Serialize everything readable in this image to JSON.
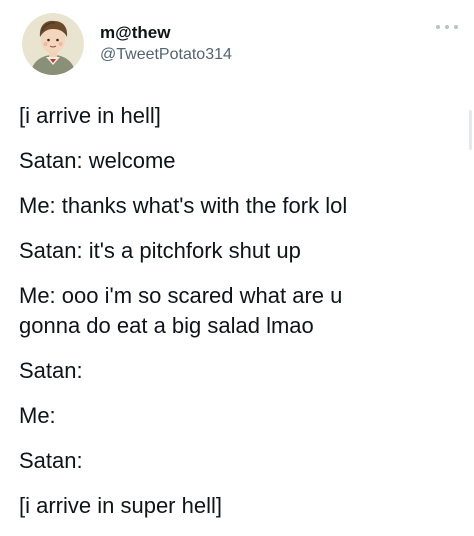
{
  "author": {
    "display_name": "m@thew",
    "handle": "@TweetPotato314",
    "avatar_icon": "cartoon-avatar"
  },
  "menu_icon": "more-dots-icon",
  "lines": [
    "[i arrive in hell]",
    "Satan: welcome",
    "Me: thanks what's with the fork lol",
    "Satan: it's a pitchfork shut up",
    "Me: ooo i'm so scared what are u",
    "gonna do eat a big salad lmao",
    "Satan:",
    "Me:",
    "Satan:",
    "[i arrive in super hell]"
  ],
  "colors": {
    "text": "#0f1419",
    "secondary": "#536471",
    "background": "#ffffff"
  }
}
